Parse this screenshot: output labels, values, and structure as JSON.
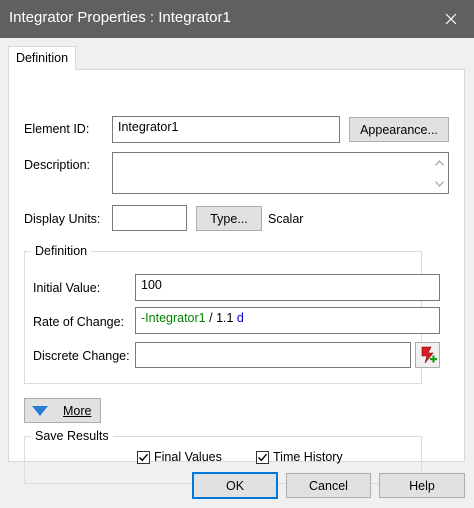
{
  "window": {
    "title": "Integrator Properties : Integrator1"
  },
  "tabs": [
    {
      "label": "Definition"
    }
  ],
  "form": {
    "element_id_label": "Element ID:",
    "element_id_value": "Integrator1",
    "appearance_button": "Appearance...",
    "description_label": "Description:",
    "description_value": "",
    "display_units_label": "Display Units:",
    "display_units_value": "",
    "type_button": "Type...",
    "type_value": "Scalar"
  },
  "definition": {
    "group_title": "Definition",
    "initial_value_label": "Initial Value:",
    "initial_value": "100",
    "rate_label": "Rate of Change:",
    "rate_tokens": {
      "negation": "-",
      "reference": "Integrator1",
      "operator": " / ",
      "number": "1.1",
      "unit": " d"
    },
    "discrete_label": "Discrete Change:",
    "discrete_value": ""
  },
  "more_button": {
    "label": "More"
  },
  "save_results": {
    "group_title": "Save Results",
    "final_values": {
      "label": "Final Values",
      "checked": true
    },
    "time_history": {
      "label": "Time History",
      "checked": true
    }
  },
  "footer": {
    "ok": "OK",
    "cancel": "Cancel",
    "help": "Help"
  },
  "colors": {
    "accent": "#0078d7",
    "reference_green": "#008000",
    "unit_blue": "#0000c8",
    "titlebar": "#606060"
  },
  "icons": {
    "close": "close-icon",
    "triangle": "triangle-down-icon",
    "insert_event": "insert-event-icon"
  }
}
